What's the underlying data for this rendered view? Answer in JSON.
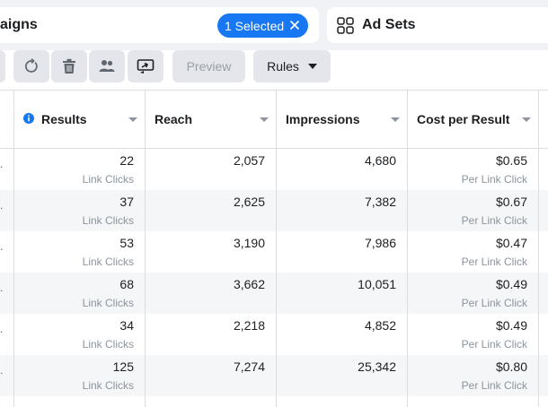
{
  "tabs": {
    "campaigns": {
      "title": "aigns",
      "selected_chip": "1 Selected"
    },
    "adsets": {
      "title": "Ad Sets"
    }
  },
  "toolbar": {
    "buttons": [
      {
        "name": "refresh-button",
        "icon": "refresh-icon"
      },
      {
        "name": "delete-button",
        "icon": "trash-icon"
      },
      {
        "name": "audience-button",
        "icon": "people-icon"
      },
      {
        "name": "export-button",
        "icon": "export-icon"
      }
    ],
    "preview_label": "Preview",
    "rules_label": "Rules"
  },
  "table": {
    "columns": [
      {
        "key": "results",
        "label": "Results"
      },
      {
        "key": "reach",
        "label": "Reach"
      },
      {
        "key": "impressions",
        "label": "Impressions"
      },
      {
        "key": "cost",
        "label": "Cost per Result"
      }
    ],
    "rows": [
      {
        "results": "22",
        "results_sub": "Link Clicks",
        "reach": "2,057",
        "impressions": "4,680",
        "cost": "$0.65",
        "cost_sub": "Per Link Click"
      },
      {
        "results": "37",
        "results_sub": "Link Clicks",
        "reach": "2,625",
        "impressions": "7,382",
        "cost": "$0.67",
        "cost_sub": "Per Link Click"
      },
      {
        "results": "53",
        "results_sub": "Link Clicks",
        "reach": "3,190",
        "impressions": "7,986",
        "cost": "$0.47",
        "cost_sub": "Per Link Click"
      },
      {
        "results": "68",
        "results_sub": "Link Clicks",
        "reach": "3,662",
        "impressions": "10,051",
        "cost": "$0.49",
        "cost_sub": "Per Link Click"
      },
      {
        "results": "34",
        "results_sub": "Link Clicks",
        "reach": "2,218",
        "impressions": "4,852",
        "cost": "$0.49",
        "cost_sub": "Per Link Click"
      },
      {
        "results": "125",
        "results_sub": "Link Clicks",
        "reach": "7,274",
        "impressions": "25,342",
        "cost": "$0.80",
        "cost_sub": "Per Link Click"
      }
    ]
  },
  "colors": {
    "accent": "#1877f2",
    "header_bg": "#f0f2f5",
    "button_bg": "#e4e6eb",
    "row_alt": "#f5f6f7"
  }
}
